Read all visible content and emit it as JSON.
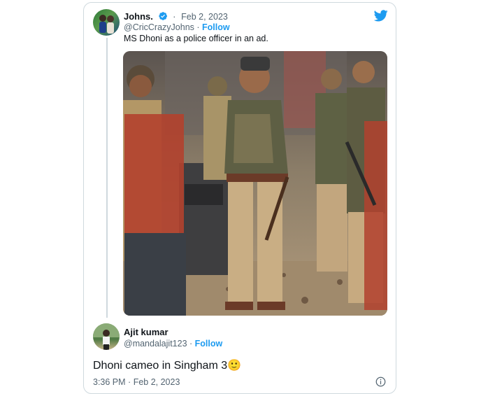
{
  "tweet": {
    "author_name": "Johns.",
    "date": "Feb 2, 2023",
    "handle": "@CricCrazyJohns",
    "follow_label": "Follow",
    "text": "MS Dhoni as a police officer in an ad."
  },
  "reply": {
    "author_name": "Ajit kumar",
    "handle": "@mandalajit123",
    "follow_label": "Follow",
    "text": "Dhoni cameo in Singham 3🙂",
    "time": "3:36 PM",
    "date": "Feb 2, 2023"
  },
  "colors": {
    "accent": "#1d9bf0",
    "muted": "#536471"
  },
  "icons": [
    "twitter-bird-icon",
    "verified-badge-icon",
    "info-icon"
  ]
}
